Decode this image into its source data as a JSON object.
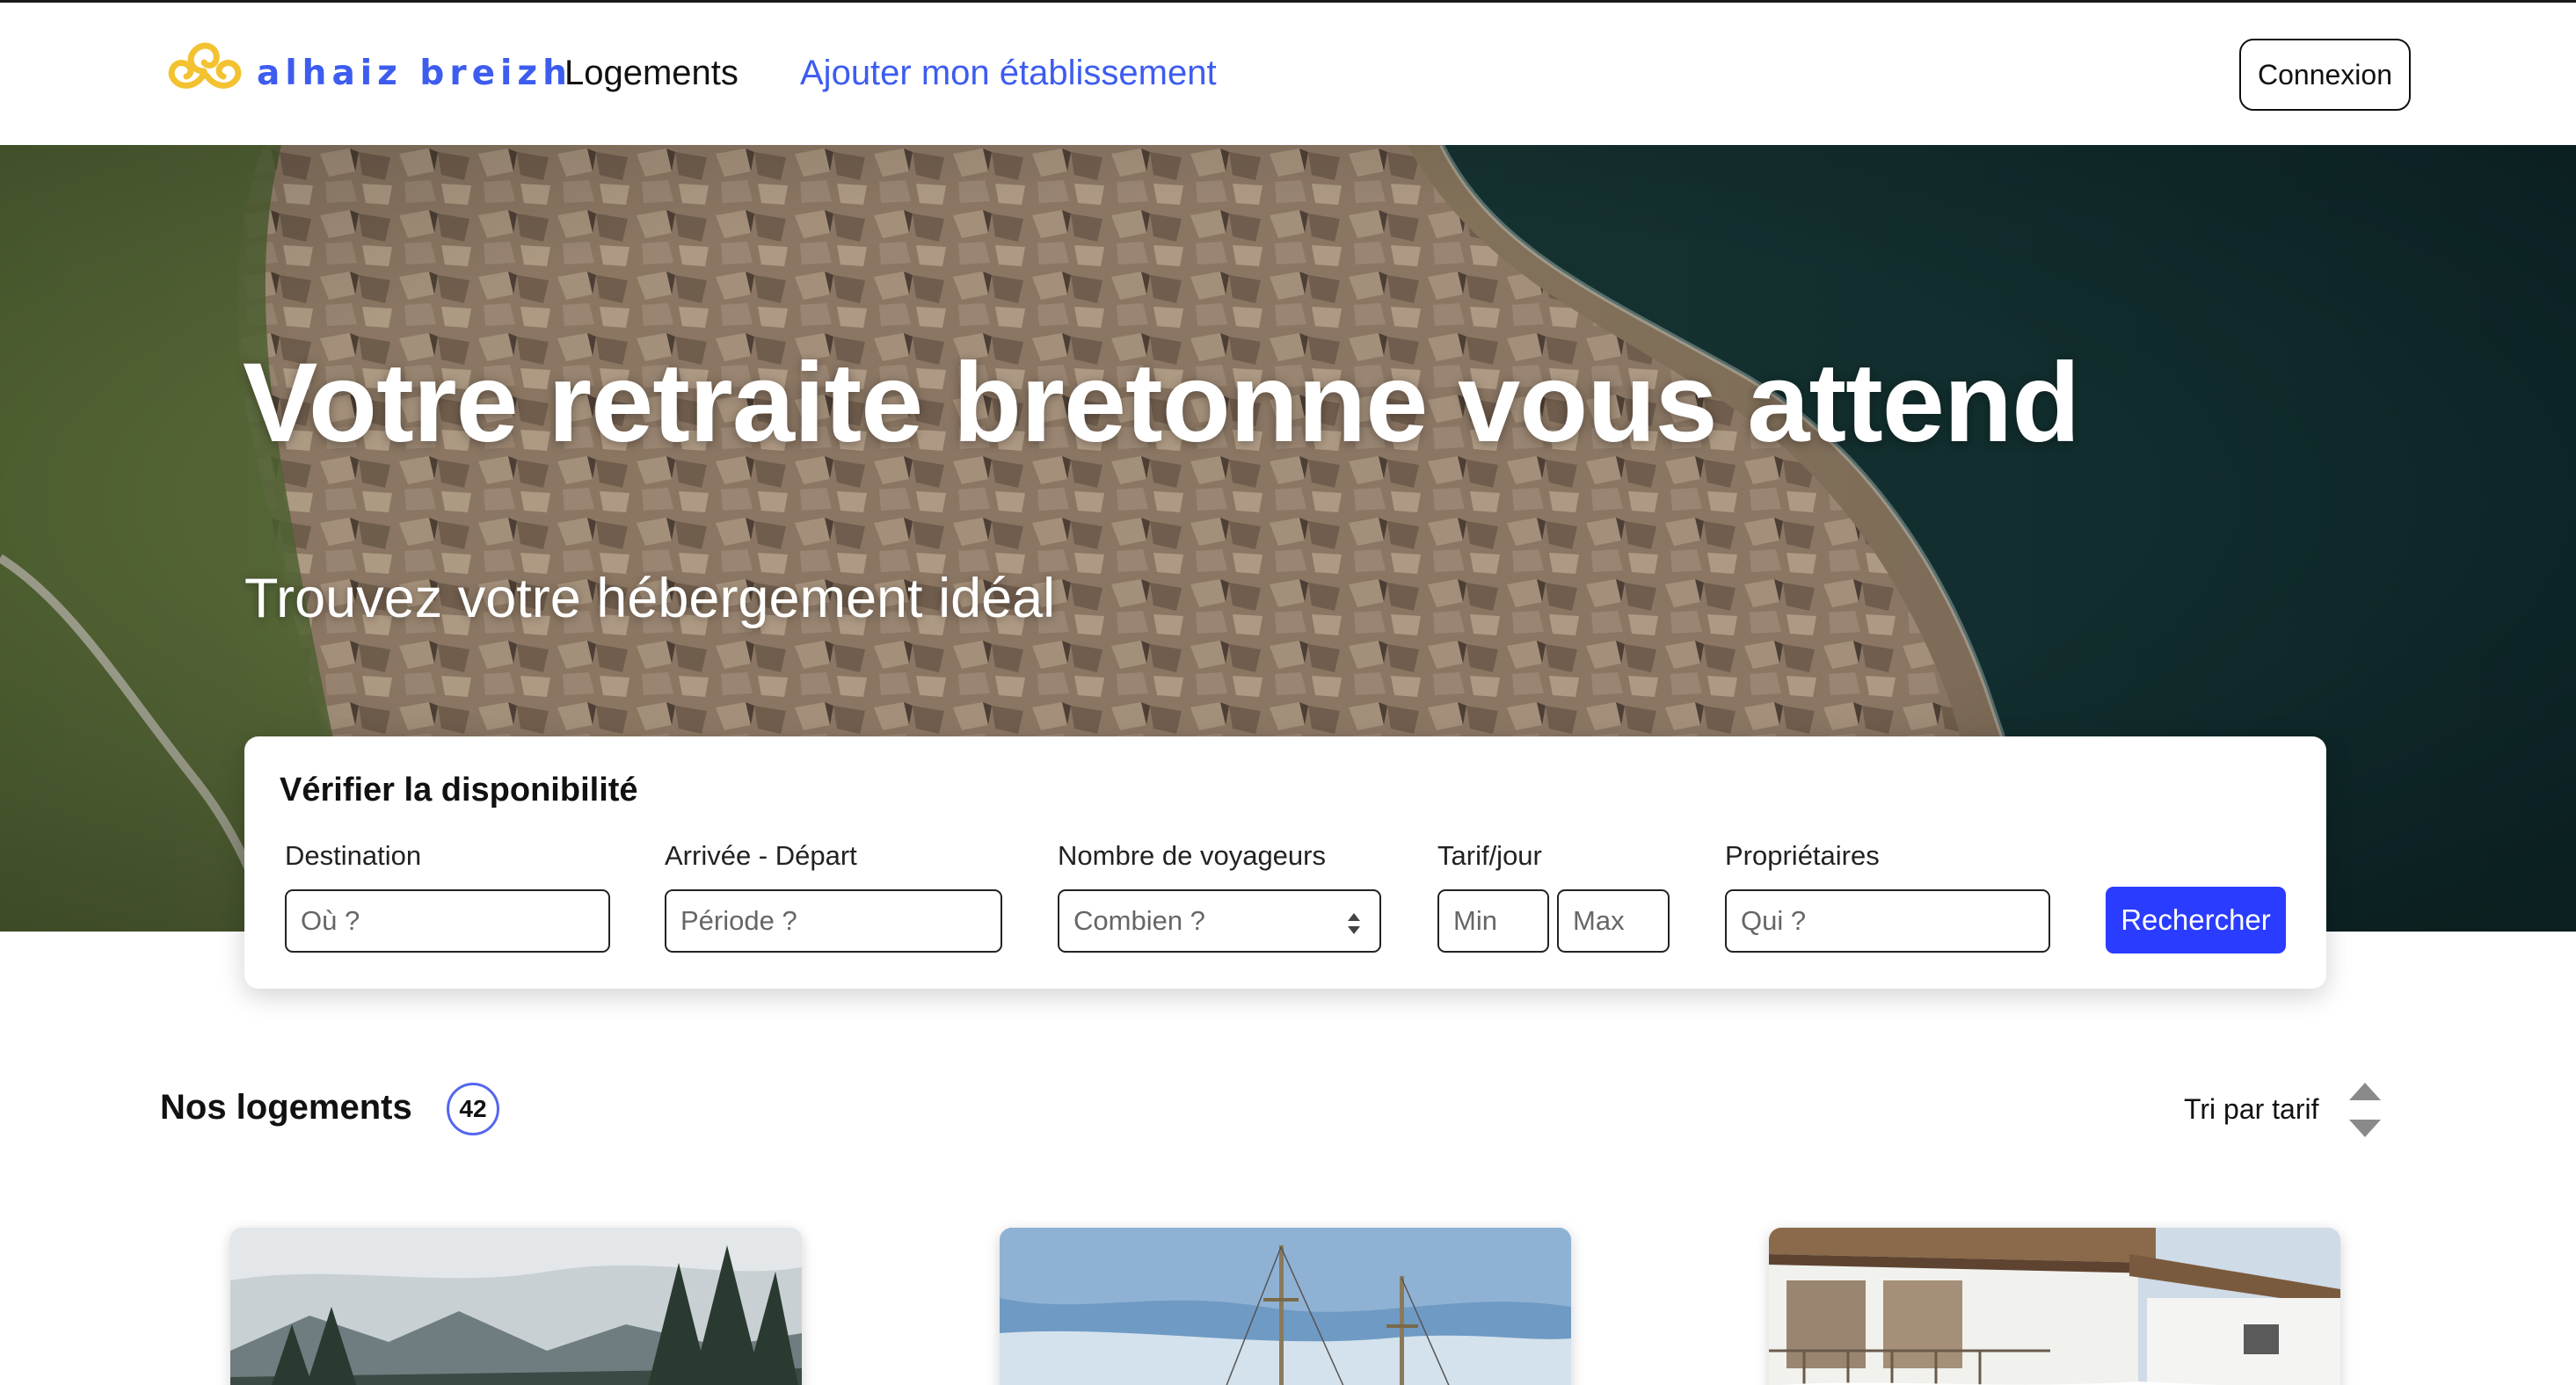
{
  "header": {
    "brand": "alhaiz breizh",
    "nav": [
      {
        "label": "Logements"
      },
      {
        "label": "Ajouter mon établissement"
      }
    ],
    "login_label": "Connexion",
    "accent_color": "#3d5cf0",
    "logo_color": "#f2c230"
  },
  "hero": {
    "title": "Votre retraite bretonne vous attend",
    "subtitle": "Trouvez votre hébergement idéal"
  },
  "search": {
    "title": "Vérifier la disponibilité",
    "fields": {
      "destination": {
        "label": "Destination",
        "placeholder": "Où ?"
      },
      "dates": {
        "label": "Arrivée - Départ",
        "placeholder": "Période ?"
      },
      "guests": {
        "label": "Nombre de voyageurs",
        "placeholder": "Combien ?"
      },
      "price": {
        "label": "Tarif/jour",
        "min_placeholder": "Min",
        "max_placeholder": "Max"
      },
      "owners": {
        "label": "Propriétaires",
        "placeholder": "Qui ?"
      }
    },
    "button_label": "Rechercher",
    "button_color": "#2a3cff"
  },
  "listings": {
    "title": "Nos logements",
    "count": "42",
    "sort_label": "Tri par tarif"
  }
}
